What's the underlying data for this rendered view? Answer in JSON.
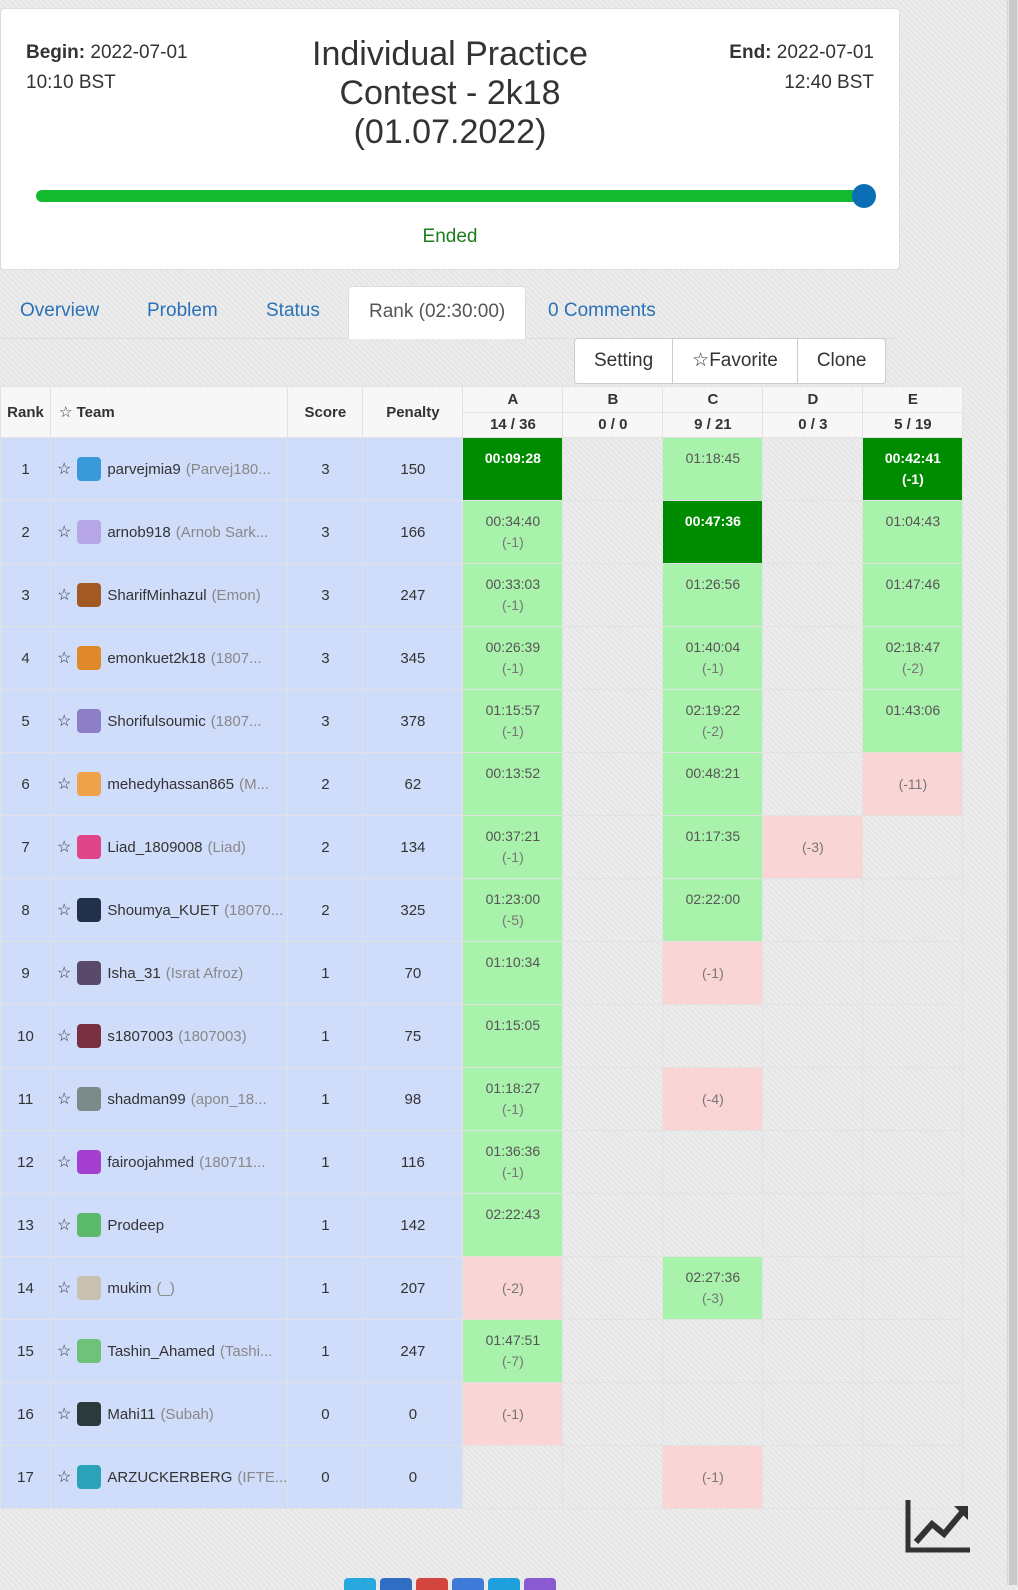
{
  "header": {
    "begin_label": "Begin:",
    "begin_date": "2022-07-01",
    "begin_time": "10:10 BST",
    "end_label": "End:",
    "end_date": "2022-07-01",
    "end_time": "12:40 BST",
    "title": "Individual Practice Contest - 2k18 (01.07.2022)",
    "progress": 1.0,
    "status": "Ended",
    "colors": {
      "progress": "#13b92e",
      "knob": "#0a6fb4",
      "status": "#1d7d1d"
    }
  },
  "tabs": [
    {
      "label": "Overview",
      "active": false
    },
    {
      "label": "Problem",
      "active": false
    },
    {
      "label": "Status",
      "active": false
    },
    {
      "label": "Rank (02:30:00)",
      "active": true
    },
    {
      "label": "0 Comments",
      "active": false
    }
  ],
  "toolbar": {
    "setting": "Setting",
    "favorite": "☆Favorite",
    "clone": "Clone"
  },
  "table": {
    "headers": {
      "rank": "Rank",
      "team": "Team",
      "team_star": "☆",
      "score": "Score",
      "penalty": "Penalty"
    },
    "problems": [
      {
        "letter": "A",
        "stat": "14 / 36"
      },
      {
        "letter": "B",
        "stat": "0 / 0"
      },
      {
        "letter": "C",
        "stat": "9 / 21"
      },
      {
        "letter": "D",
        "stat": "0 / 3"
      },
      {
        "letter": "E",
        "stat": "5 / 19"
      }
    ],
    "rows": [
      {
        "rank": "1",
        "name": "parvejmia9",
        "nick": "(Parvej180...",
        "score": "3",
        "penalty": "150",
        "avatar": "#3a9ad9",
        "cells": [
          {
            "s": "fb",
            "t": "00:09:28",
            "a": ""
          },
          {
            "s": "empty"
          },
          {
            "s": "ac",
            "t": "01:18:45",
            "a": ""
          },
          {
            "s": "empty"
          },
          {
            "s": "fb",
            "t": "00:42:41",
            "a": "(-1)"
          }
        ]
      },
      {
        "rank": "2",
        "name": "arnob918",
        "nick": "(Arnob Sark...",
        "score": "3",
        "penalty": "166",
        "avatar": "#b6a6e6",
        "cells": [
          {
            "s": "ac",
            "t": "00:34:40",
            "a": "(-1)"
          },
          {
            "s": "empty"
          },
          {
            "s": "fb",
            "t": "00:47:36",
            "a": ""
          },
          {
            "s": "empty"
          },
          {
            "s": "ac",
            "t": "01:04:43",
            "a": ""
          }
        ]
      },
      {
        "rank": "3",
        "name": "SharifMinhazul",
        "nick": "(Emon)",
        "score": "3",
        "penalty": "247",
        "avatar": "#a35a22",
        "cells": [
          {
            "s": "ac",
            "t": "00:33:03",
            "a": "(-1)"
          },
          {
            "s": "empty"
          },
          {
            "s": "ac",
            "t": "01:26:56",
            "a": ""
          },
          {
            "s": "empty"
          },
          {
            "s": "ac",
            "t": "01:47:46",
            "a": ""
          }
        ]
      },
      {
        "rank": "4",
        "name": "emonkuet2k18",
        "nick": "(1807...",
        "score": "3",
        "penalty": "345",
        "avatar": "#e0892a",
        "cells": [
          {
            "s": "ac",
            "t": "00:26:39",
            "a": "(-1)"
          },
          {
            "s": "empty"
          },
          {
            "s": "ac",
            "t": "01:40:04",
            "a": "(-1)"
          },
          {
            "s": "empty"
          },
          {
            "s": "ac",
            "t": "02:18:47",
            "a": "(-2)"
          }
        ]
      },
      {
        "rank": "5",
        "name": "Shorifulsoumic",
        "nick": "(1807...",
        "score": "3",
        "penalty": "378",
        "avatar": "#8c7fc8",
        "cells": [
          {
            "s": "ac",
            "t": "01:15:57",
            "a": "(-1)"
          },
          {
            "s": "empty"
          },
          {
            "s": "ac",
            "t": "02:19:22",
            "a": "(-2)"
          },
          {
            "s": "empty"
          },
          {
            "s": "ac",
            "t": "01:43:06",
            "a": ""
          }
        ]
      },
      {
        "rank": "6",
        "name": "mehedyhassan865",
        "nick": "(M...",
        "score": "2",
        "penalty": "62",
        "avatar": "#f0a24a",
        "cells": [
          {
            "s": "ac",
            "t": "00:13:52",
            "a": ""
          },
          {
            "s": "empty"
          },
          {
            "s": "ac",
            "t": "00:48:21",
            "a": ""
          },
          {
            "s": "empty"
          },
          {
            "s": "wa",
            "t": "",
            "a": "(-11)"
          }
        ]
      },
      {
        "rank": "7",
        "name": "Liad_1809008",
        "nick": "(Liad)",
        "score": "2",
        "penalty": "134",
        "avatar": "#e0458a",
        "cells": [
          {
            "s": "ac",
            "t": "00:37:21",
            "a": "(-1)"
          },
          {
            "s": "empty"
          },
          {
            "s": "ac",
            "t": "01:17:35",
            "a": ""
          },
          {
            "s": "wa",
            "t": "",
            "a": "(-3)"
          },
          {
            "s": "empty"
          }
        ]
      },
      {
        "rank": "8",
        "name": "Shoumya_KUET",
        "nick": "(18070...",
        "score": "2",
        "penalty": "325",
        "avatar": "#22304a",
        "cells": [
          {
            "s": "ac",
            "t": "01:23:00",
            "a": "(-5)"
          },
          {
            "s": "empty"
          },
          {
            "s": "ac",
            "t": "02:22:00",
            "a": ""
          },
          {
            "s": "empty"
          },
          {
            "s": "empty"
          }
        ]
      },
      {
        "rank": "9",
        "name": "Isha_31",
        "nick": "(Israt Afroz)",
        "score": "1",
        "penalty": "70",
        "avatar": "#5a4a6a",
        "cells": [
          {
            "s": "ac",
            "t": "01:10:34",
            "a": ""
          },
          {
            "s": "empty"
          },
          {
            "s": "wa",
            "t": "",
            "a": "(-1)"
          },
          {
            "s": "empty"
          },
          {
            "s": "empty"
          }
        ]
      },
      {
        "rank": "10",
        "name": "s1807003",
        "nick": "(1807003)",
        "score": "1",
        "penalty": "75",
        "avatar": "#7a3040",
        "cells": [
          {
            "s": "ac",
            "t": "01:15:05",
            "a": ""
          },
          {
            "s": "empty"
          },
          {
            "s": "empty"
          },
          {
            "s": "empty"
          },
          {
            "s": "empty"
          }
        ]
      },
      {
        "rank": "11",
        "name": "shadman99",
        "nick": "(apon_18...",
        "score": "1",
        "penalty": "98",
        "avatar": "#7d8a8a",
        "cells": [
          {
            "s": "ac",
            "t": "01:18:27",
            "a": "(-1)"
          },
          {
            "s": "empty"
          },
          {
            "s": "wa",
            "t": "",
            "a": "(-4)"
          },
          {
            "s": "empty"
          },
          {
            "s": "empty"
          }
        ]
      },
      {
        "rank": "12",
        "name": "fairoojahmed",
        "nick": "(180711...",
        "score": "1",
        "penalty": "116",
        "avatar": "#a43fd0",
        "cells": [
          {
            "s": "ac",
            "t": "01:36:36",
            "a": "(-1)"
          },
          {
            "s": "empty"
          },
          {
            "s": "empty"
          },
          {
            "s": "empty"
          },
          {
            "s": "empty"
          }
        ]
      },
      {
        "rank": "13",
        "name": "Prodeep",
        "nick": "",
        "score": "1",
        "penalty": "142",
        "avatar": "#5cbb6a",
        "cells": [
          {
            "s": "ac",
            "t": "02:22:43",
            "a": ""
          },
          {
            "s": "empty"
          },
          {
            "s": "empty"
          },
          {
            "s": "empty"
          },
          {
            "s": "empty"
          }
        ]
      },
      {
        "rank": "14",
        "name": "mukim",
        "nick": "(_)",
        "score": "1",
        "penalty": "207",
        "avatar": "#c8c0b0",
        "cells": [
          {
            "s": "wa",
            "t": "",
            "a": "(-2)"
          },
          {
            "s": "empty"
          },
          {
            "s": "ac",
            "t": "02:27:36",
            "a": "(-3)"
          },
          {
            "s": "empty"
          },
          {
            "s": "empty"
          }
        ]
      },
      {
        "rank": "15",
        "name": "Tashin_Ahamed",
        "nick": "(Tashi...",
        "score": "1",
        "penalty": "247",
        "avatar": "#6fc27a",
        "cells": [
          {
            "s": "ac",
            "t": "01:47:51",
            "a": "(-7)"
          },
          {
            "s": "empty"
          },
          {
            "s": "empty"
          },
          {
            "s": "empty"
          },
          {
            "s": "empty"
          }
        ]
      },
      {
        "rank": "16",
        "name": "Mahi11",
        "nick": "(Subah)",
        "score": "0",
        "penalty": "0",
        "avatar": "#2b3a3a",
        "cells": [
          {
            "s": "wa",
            "t": "",
            "a": "(-1)"
          },
          {
            "s": "empty"
          },
          {
            "s": "empty"
          },
          {
            "s": "empty"
          },
          {
            "s": "empty"
          }
        ]
      },
      {
        "rank": "17",
        "name": "ARZUCKERBERG",
        "nick": "(IFTE...",
        "score": "0",
        "penalty": "0",
        "avatar": "#2aa3b8",
        "cells": [
          {
            "s": "empty"
          },
          {
            "s": "empty"
          },
          {
            "s": "wa",
            "t": "",
            "a": "(-1)"
          },
          {
            "s": "empty"
          },
          {
            "s": "empty"
          }
        ]
      }
    ]
  },
  "footer": {
    "chart_icon": "trend-chart-icon",
    "share_colors": [
      "#29a8e0",
      "#2f6ec3",
      "#d3463d",
      "#3e7ad8",
      "#1ea0dc",
      "#8a5ad0"
    ]
  }
}
